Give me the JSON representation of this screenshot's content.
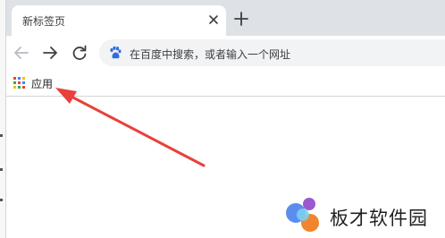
{
  "tab": {
    "title": "新标签页"
  },
  "toolbar": {
    "omnibox_placeholder": "在百度中搜索，或者输入一个网址"
  },
  "bookmarks": {
    "apps_label": "应用"
  },
  "watermark": {
    "text": "板才软件园"
  },
  "colors": {
    "annotation_arrow": "#e8413a",
    "tab_strip": "#dee1e6",
    "omnibox_bg": "#f1f3f4",
    "baidu_blue": "#2f6de1"
  },
  "icons": [
    "close-icon",
    "plus-icon",
    "back-arrow-icon",
    "forward-arrow-icon",
    "reload-icon",
    "baidu-paw-icon",
    "apps-grid-icon"
  ]
}
